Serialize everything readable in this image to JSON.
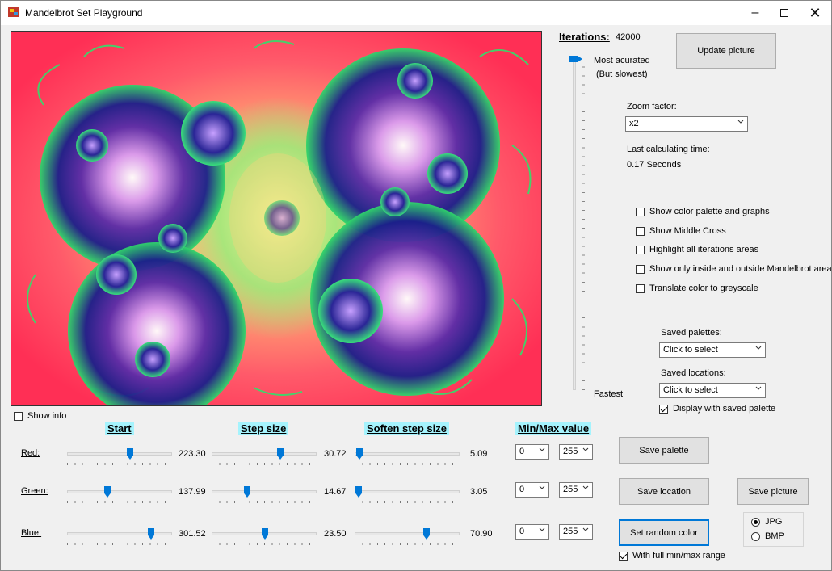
{
  "window": {
    "title": "Mandelbrot Set Playground"
  },
  "iterations": {
    "label": "Iterations:",
    "value": "42000",
    "top_label": "Most acurated",
    "top_sub": "(But slowest)",
    "bottom_label": "Fastest",
    "level": 1.0
  },
  "buttons": {
    "update": "Update picture",
    "save_palette": "Save  palette",
    "save_location": "Save location",
    "save_picture": "Save picture",
    "random_color": "Set random color"
  },
  "zoom": {
    "label": "Zoom factor:",
    "value": "x2"
  },
  "calc_time": {
    "label": "Last calculating time:",
    "value": "0.17 Seconds"
  },
  "options": [
    {
      "label": "Show color palette and graphs",
      "checked": false
    },
    {
      "label": "Show Middle Cross",
      "checked": false
    },
    {
      "label": "Highlight all iterations areas",
      "checked": false
    },
    {
      "label": "Show only inside and outside Mandelbrot areas",
      "checked": false
    },
    {
      "label": "Translate color to greyscale",
      "checked": false
    }
  ],
  "saved_palettes": {
    "label": "Saved palettes:",
    "value": "Click to select"
  },
  "saved_locations": {
    "label": "Saved locations:",
    "value": "Click to select"
  },
  "display_saved_palette": {
    "label": "Display with saved palette",
    "checked": true
  },
  "show_info": {
    "label": "Show info",
    "checked": false
  },
  "headers": {
    "start": "Start",
    "step": "Step size",
    "soften": "Soften step size",
    "minmax": "Min/Max value"
  },
  "channels": [
    {
      "name": "Red:",
      "start": "223.30",
      "start_pos": 0.61,
      "step": "30.72",
      "step_pos": 0.66,
      "soften": "5.09",
      "soften_pos": 0.02,
      "min": "0",
      "max": "255"
    },
    {
      "name": "Green:",
      "start": "137.99",
      "start_pos": 0.38,
      "step": "14.67",
      "step_pos": 0.33,
      "soften": "3.05",
      "soften_pos": 0.01,
      "min": "0",
      "max": "255"
    },
    {
      "name": "Blue:",
      "start": "301.52",
      "start_pos": 0.82,
      "step": "23.50",
      "step_pos": 0.51,
      "soften": "70.90",
      "soften_pos": 0.7,
      "min": "0",
      "max": "255"
    }
  ],
  "full_range": {
    "label": "With full min/max range",
    "checked": true
  },
  "format": [
    {
      "label": "JPG",
      "checked": true
    },
    {
      "label": "BMP",
      "checked": false
    }
  ]
}
